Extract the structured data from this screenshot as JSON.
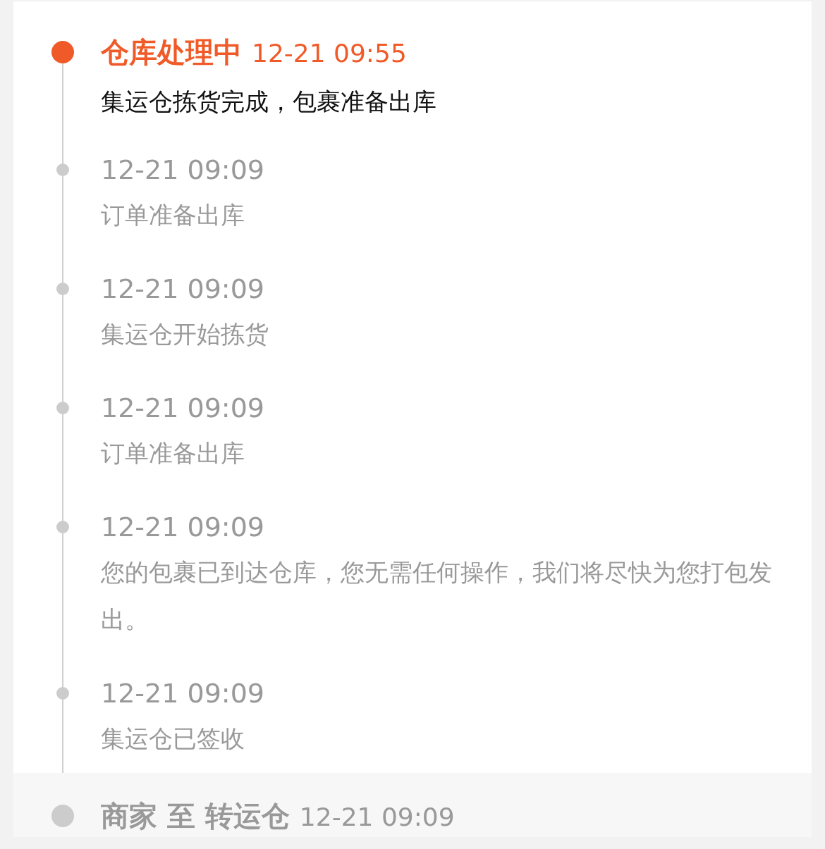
{
  "timeline": [
    {
      "kind": "current",
      "status": "仓库处理中",
      "time": "12-21 09:55",
      "description": "集运仓拣货完成，包裹准备出库"
    },
    {
      "kind": "past",
      "time": "12-21 09:09",
      "description": "订单准备出库"
    },
    {
      "kind": "past",
      "time": "12-21 09:09",
      "description": "集运仓开始拣货"
    },
    {
      "kind": "past",
      "time": "12-21 09:09",
      "description": "订单准备出库"
    },
    {
      "kind": "past",
      "time": "12-21 09:09",
      "description": "您的包裹已到达仓库，您无需任何操作，我们将尽快为您打包发出。"
    },
    {
      "kind": "past",
      "time": "12-21 09:09",
      "description": "集运仓已签收"
    }
  ],
  "next_segment": {
    "title": "商家 至 转运仓",
    "time": "12-21 09:09"
  }
}
